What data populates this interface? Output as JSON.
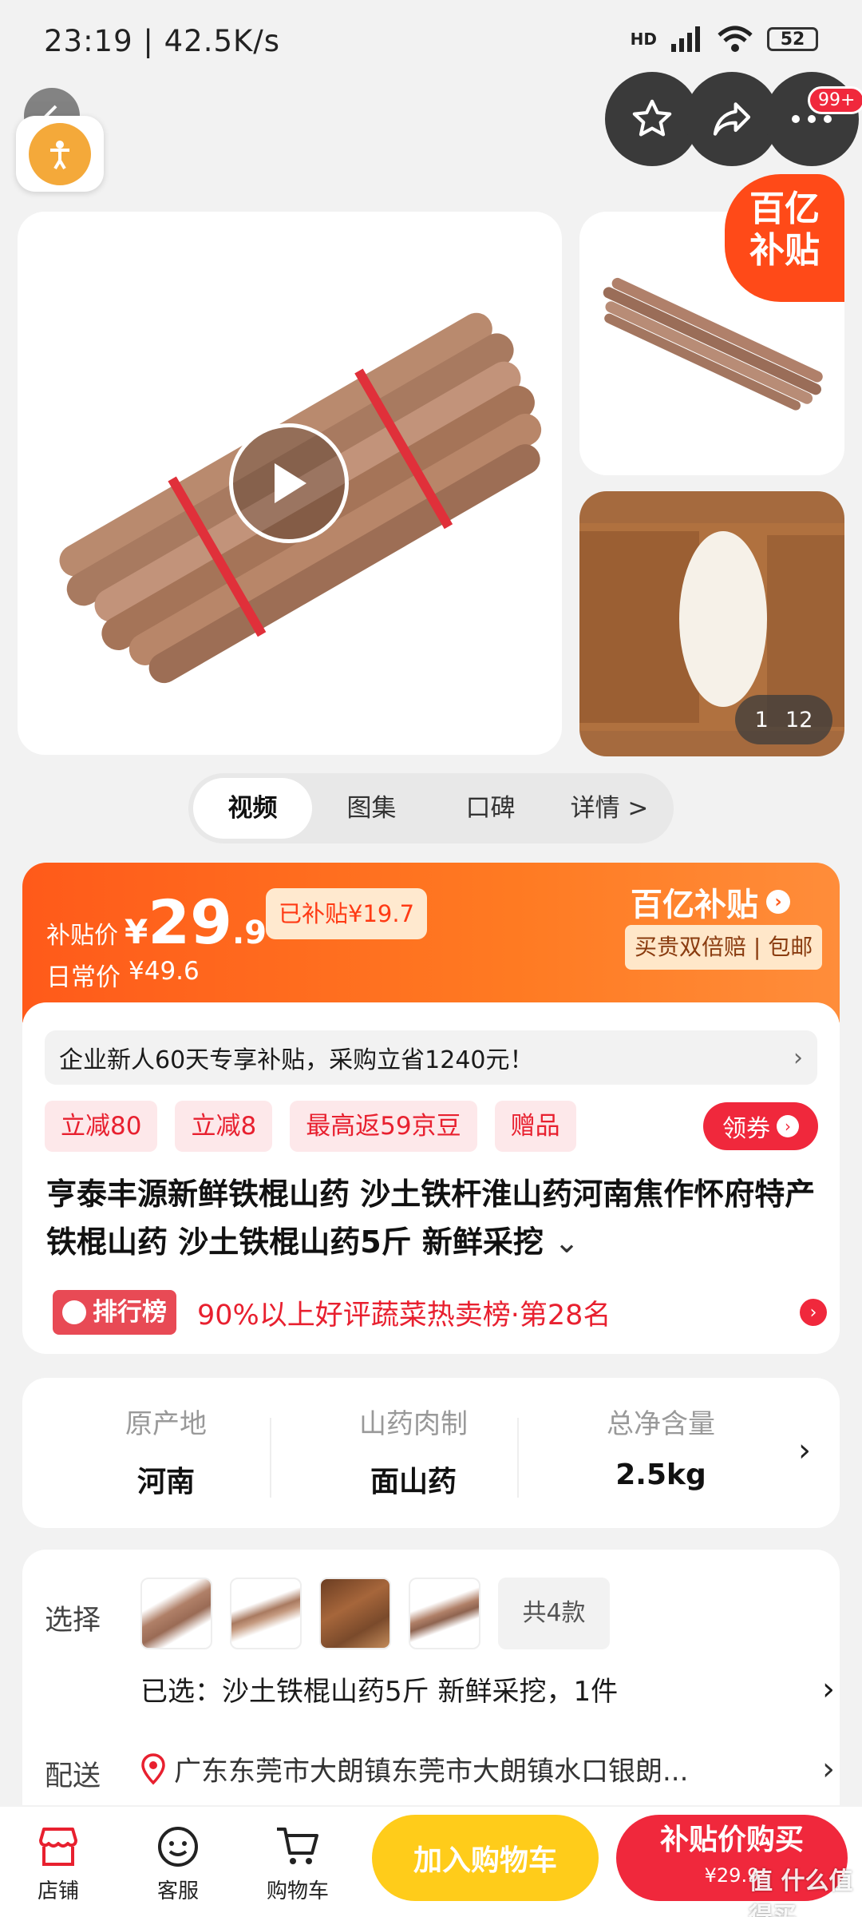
{
  "status_bar": {
    "time": "23:19 | 42.5K/s",
    "network": "HD",
    "battery": "52"
  },
  "top_actions": {
    "badge": "99+"
  },
  "gallery": {
    "subsidy_badge_line1": "百亿",
    "subsidy_badge_line2": "补贴",
    "counter_current": "1",
    "counter_total": "12"
  },
  "tabs": [
    {
      "label": "视频"
    },
    {
      "label": "图集"
    },
    {
      "label": "口碑"
    },
    {
      "label": "详情 >"
    }
  ],
  "price": {
    "label": "补贴价",
    "currency": "¥",
    "integer": "29",
    "decimal": ".9",
    "subsidized": "已补贴¥19.7",
    "daily_label": "日常价",
    "daily_price": "¥49.6",
    "brand": "百亿补贴",
    "guarantee": "买贵双倍赔 | 包邮"
  },
  "promo": {
    "notice": "企业新人60天专享补贴，采购立省1240元！",
    "tags": [
      "立减80",
      "立减8",
      "最高返59京豆",
      "赠品"
    ],
    "coupon_button": "领券",
    "title": "亨泰丰源新鲜铁棍山药 沙土铁杆淮山药河南焦作怀府特产铁棍山药 沙土铁棍山药5斤 新鲜采挖",
    "rank_badge": "排行榜",
    "rank_text": "90%以上好评蔬菜热卖榜·第28名"
  },
  "specs": [
    {
      "label": "原产地",
      "value": "河南"
    },
    {
      "label": "山药肉制",
      "value": "面山药"
    },
    {
      "label": "总净含量",
      "value": "2.5kg"
    }
  ],
  "selection": {
    "label": "选择",
    "count": "共4款",
    "selected": "已选：沙土铁棍山药5斤 新鲜采挖，1件",
    "delivery_label": "配送",
    "address": "广东东莞市大朗镇东莞市大朗镇水口银朗..."
  },
  "bottom_bar": {
    "shop": "店铺",
    "service": "客服",
    "cart": "购物车",
    "add_cart": "加入购物车",
    "buy": "补贴价购买",
    "buy_price": "¥29.9",
    "watermark": "值 什么值得买"
  }
}
